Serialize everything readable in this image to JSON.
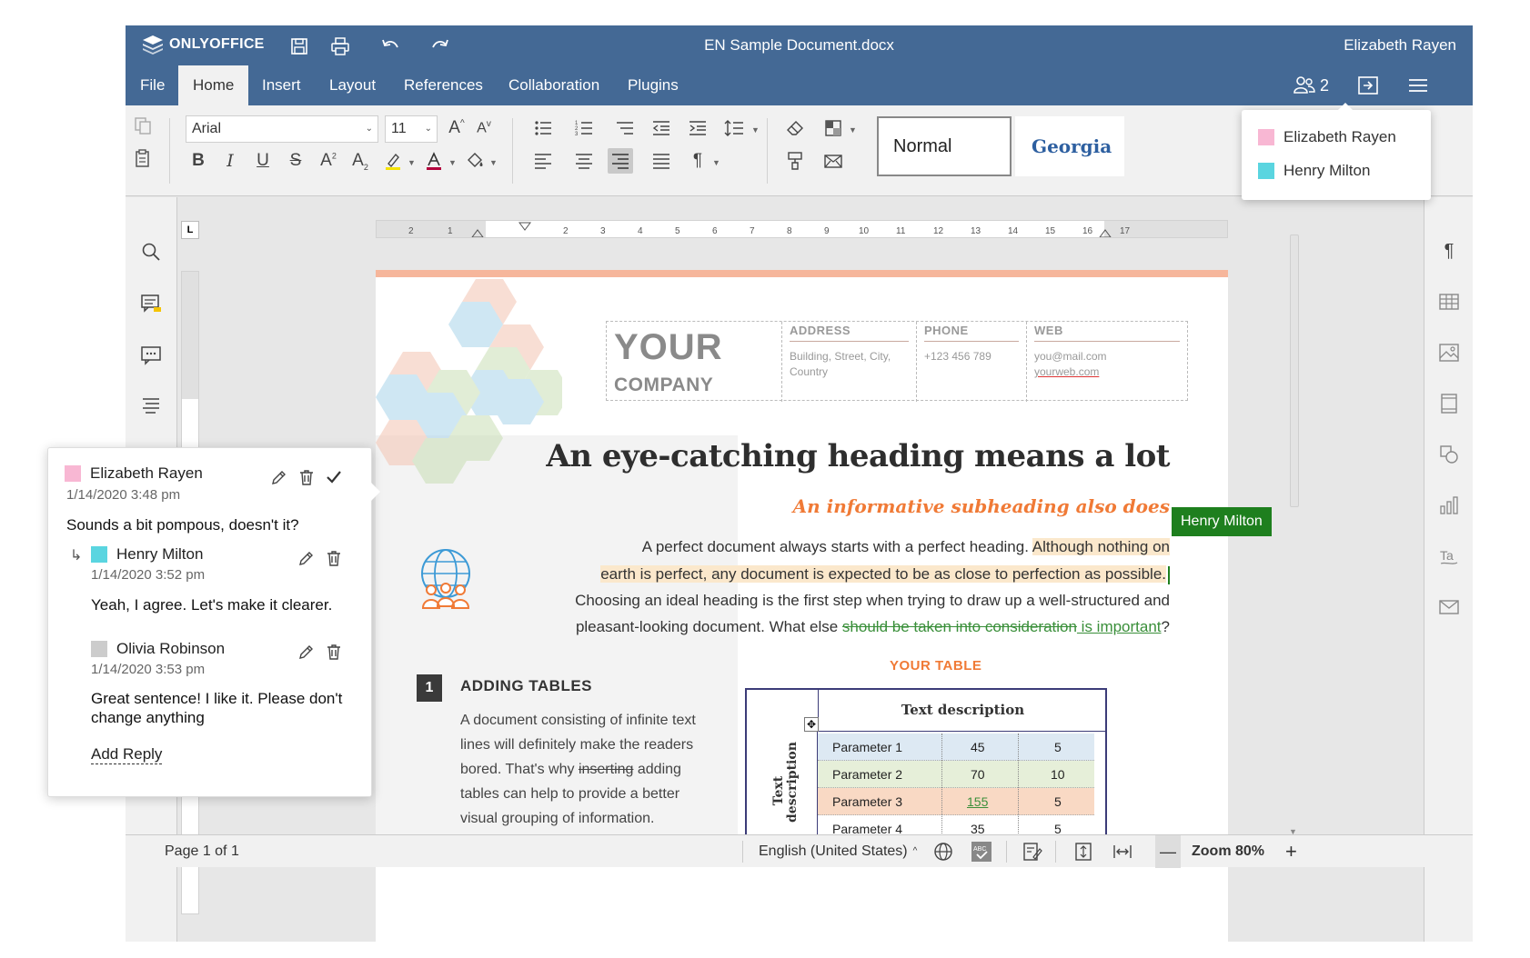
{
  "title_bar": {
    "logo_text": "ONLYOFFICE",
    "document_title": "EN Sample Document.docx",
    "user_name": "Elizabeth Rayen"
  },
  "menu": {
    "tabs": [
      "File",
      "Home",
      "Insert",
      "Layout",
      "References",
      "Collaboration",
      "Plugins"
    ],
    "active_tab": "Home",
    "users_count": "2"
  },
  "toolbar": {
    "font_name": "Arial",
    "font_size": "11",
    "styles": [
      "Normal",
      "Georgia"
    ]
  },
  "users_popup": {
    "users": [
      {
        "name": "Elizabeth Rayen",
        "color": "#f8b7d3"
      },
      {
        "name": "Henry Milton",
        "color": "#5ad5e0"
      }
    ]
  },
  "document": {
    "company_your": "YOUR",
    "company_company": "COMPANY",
    "address_label": "ADDRESS",
    "address_value": "Building, Street, City, Country",
    "phone_label": "PHONE",
    "phone_value": "+123 456 789",
    "web_label": "WEB",
    "web_value_1": "you@mail.com",
    "web_value_2": "yourweb.com",
    "heading": "An eye-catching heading means a lot",
    "subheading": "An informative subheading also does",
    "para_line1_a": "A perfect document always starts with a perfect heading.",
    "para_line1_b": "Although nothing on",
    "para_line2": "earth is perfect, any document is expected to be as close to perfection as possible.",
    "para_line3": "Choosing an ideal heading is the first step when trying to draw up a well-structured and",
    "para_line4_a": "pleasant-looking document. What else",
    "para_line4_del": "should be taken into consideration",
    "para_line4_ins": " is important",
    "para_line4_end": "?",
    "cursor_user": "Henry Milton",
    "section_number": "1",
    "section_title": "ADDING TABLES",
    "section_text_1": "A document consisting of infinite text lines will definitely make the readers bored. That's why",
    "section_text_del": "inserting",
    "section_text_2": " adding tables can help to provide a better visual grouping of information.",
    "table_title": "YOUR TABLE",
    "table_header": "Text description",
    "table_side": "Text description",
    "table_rows": [
      {
        "label": "Parameter 1",
        "v1": "45",
        "v2": "5",
        "color": "#dde9f3"
      },
      {
        "label": "Parameter 2",
        "v1": "70",
        "v2": "10",
        "color": "#e6efd9"
      },
      {
        "label": "Parameter 3",
        "v1": "155",
        "v2": "5",
        "color": "#f9d9c4"
      },
      {
        "label": "Parameter 4",
        "v1": "35",
        "v2": "5",
        "color": "#ffffff"
      }
    ]
  },
  "comments": {
    "main": {
      "author": "Elizabeth Rayen",
      "date": "1/14/2020 3:48 pm",
      "text": "Sounds a bit pompous, doesn't it?",
      "color": "#f8b7d3"
    },
    "replies": [
      {
        "author": "Henry Milton",
        "date": "1/14/2020 3:52 pm",
        "text": "Yeah, I agree. Let's make it clearer.",
        "color": "#5ad5e0"
      },
      {
        "author": "Olivia Robinson",
        "date": "1/14/2020 3:53 pm",
        "text": "Great sentence! I like it. Please don't change anything",
        "color": "#cccccc"
      }
    ],
    "add_reply": "Add Reply"
  },
  "status_bar": {
    "page_info": "Page 1 of 1",
    "language": "English (United States)",
    "zoom": "Zoom 80%"
  }
}
